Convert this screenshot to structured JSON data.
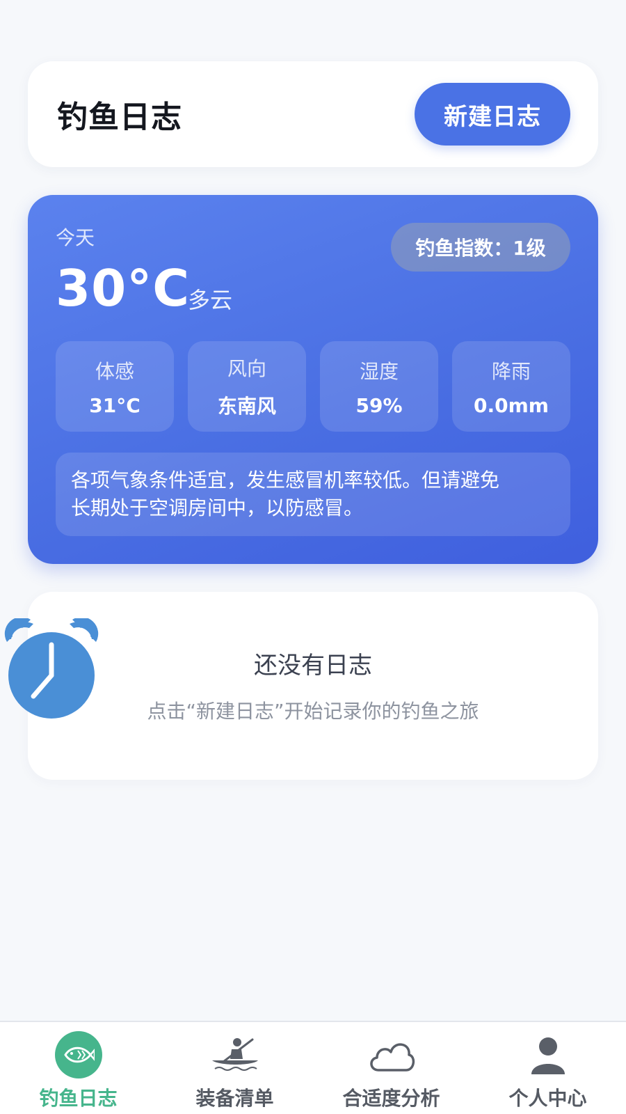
{
  "header": {
    "title": "钓鱼日志",
    "new_button_label": "新建日志"
  },
  "weather": {
    "today_label": "今天",
    "temperature": "30°C",
    "condition": "多云",
    "fishing_index": "钓鱼指数：1级",
    "stats": [
      {
        "label": "体感",
        "value": "31°C"
      },
      {
        "label": "风向",
        "value": "东南风"
      },
      {
        "label": "湿度",
        "value": "59%"
      },
      {
        "label": "降雨",
        "value": "0.0mm"
      }
    ],
    "advice_line1": "各项气象条件适宜，发生感冒机率较低。但请避免",
    "advice_line2": "长期处于空调房间中，以防感冒。"
  },
  "empty_state": {
    "title": "还没有日志",
    "subtitle": "点击“新建日志”开始记录你的钓鱼之旅",
    "icon": "alarm-clock-icon"
  },
  "tabbar": {
    "items": [
      {
        "label": "钓鱼日志",
        "icon": "fish-icon",
        "active": true
      },
      {
        "label": "装备清单",
        "icon": "kayak-icon",
        "active": false
      },
      {
        "label": "合适度分析",
        "icon": "cloud-icon",
        "active": false
      },
      {
        "label": "个人中心",
        "icon": "user-icon",
        "active": false
      }
    ]
  },
  "colors": {
    "accent": "#4a72e5",
    "active_tab": "#46b58c",
    "weather_card": "#4a6fe3"
  }
}
